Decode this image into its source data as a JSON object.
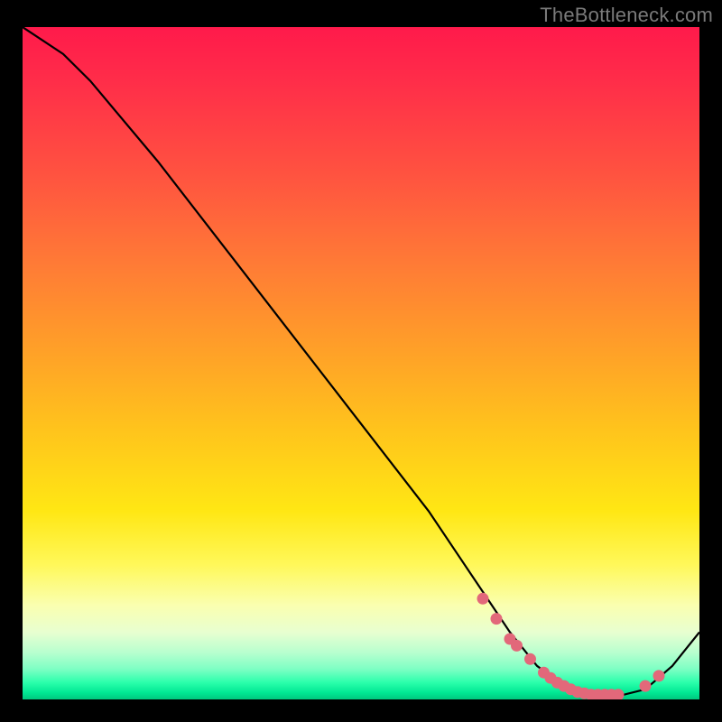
{
  "watermark": "TheBottleneck.com",
  "chart_data": {
    "type": "line",
    "title": "",
    "xlabel": "",
    "ylabel": "",
    "xlim": [
      0,
      100
    ],
    "ylim": [
      0,
      100
    ],
    "series": [
      {
        "name": "curve",
        "color": "#000000",
        "x": [
          0,
          6,
          10,
          20,
          30,
          40,
          50,
          60,
          68,
          72,
          76,
          80,
          84,
          88,
          92,
          96,
          100
        ],
        "y": [
          100,
          96,
          92,
          80,
          67,
          54,
          41,
          28,
          16,
          10,
          5,
          2,
          0.5,
          0.5,
          1.5,
          5,
          10
        ]
      }
    ],
    "markers": {
      "name": "highlight-points",
      "color": "#e2687a",
      "x": [
        68,
        70,
        72,
        73,
        75,
        77,
        78,
        79,
        80,
        81,
        82,
        83,
        84,
        85,
        86,
        87,
        88,
        92,
        94
      ],
      "y": [
        15,
        12,
        9,
        8,
        6,
        4,
        3.2,
        2.5,
        2,
        1.5,
        1.1,
        0.9,
        0.7,
        0.7,
        0.7,
        0.7,
        0.7,
        2,
        3.5
      ]
    },
    "gradient_stops": [
      {
        "pos": 0.0,
        "color": "#ff1a4b"
      },
      {
        "pos": 0.35,
        "color": "#ff7a36"
      },
      {
        "pos": 0.72,
        "color": "#ffe714"
      },
      {
        "pos": 0.9,
        "color": "#e8ffd0"
      },
      {
        "pos": 1.0,
        "color": "#00c87e"
      }
    ]
  }
}
